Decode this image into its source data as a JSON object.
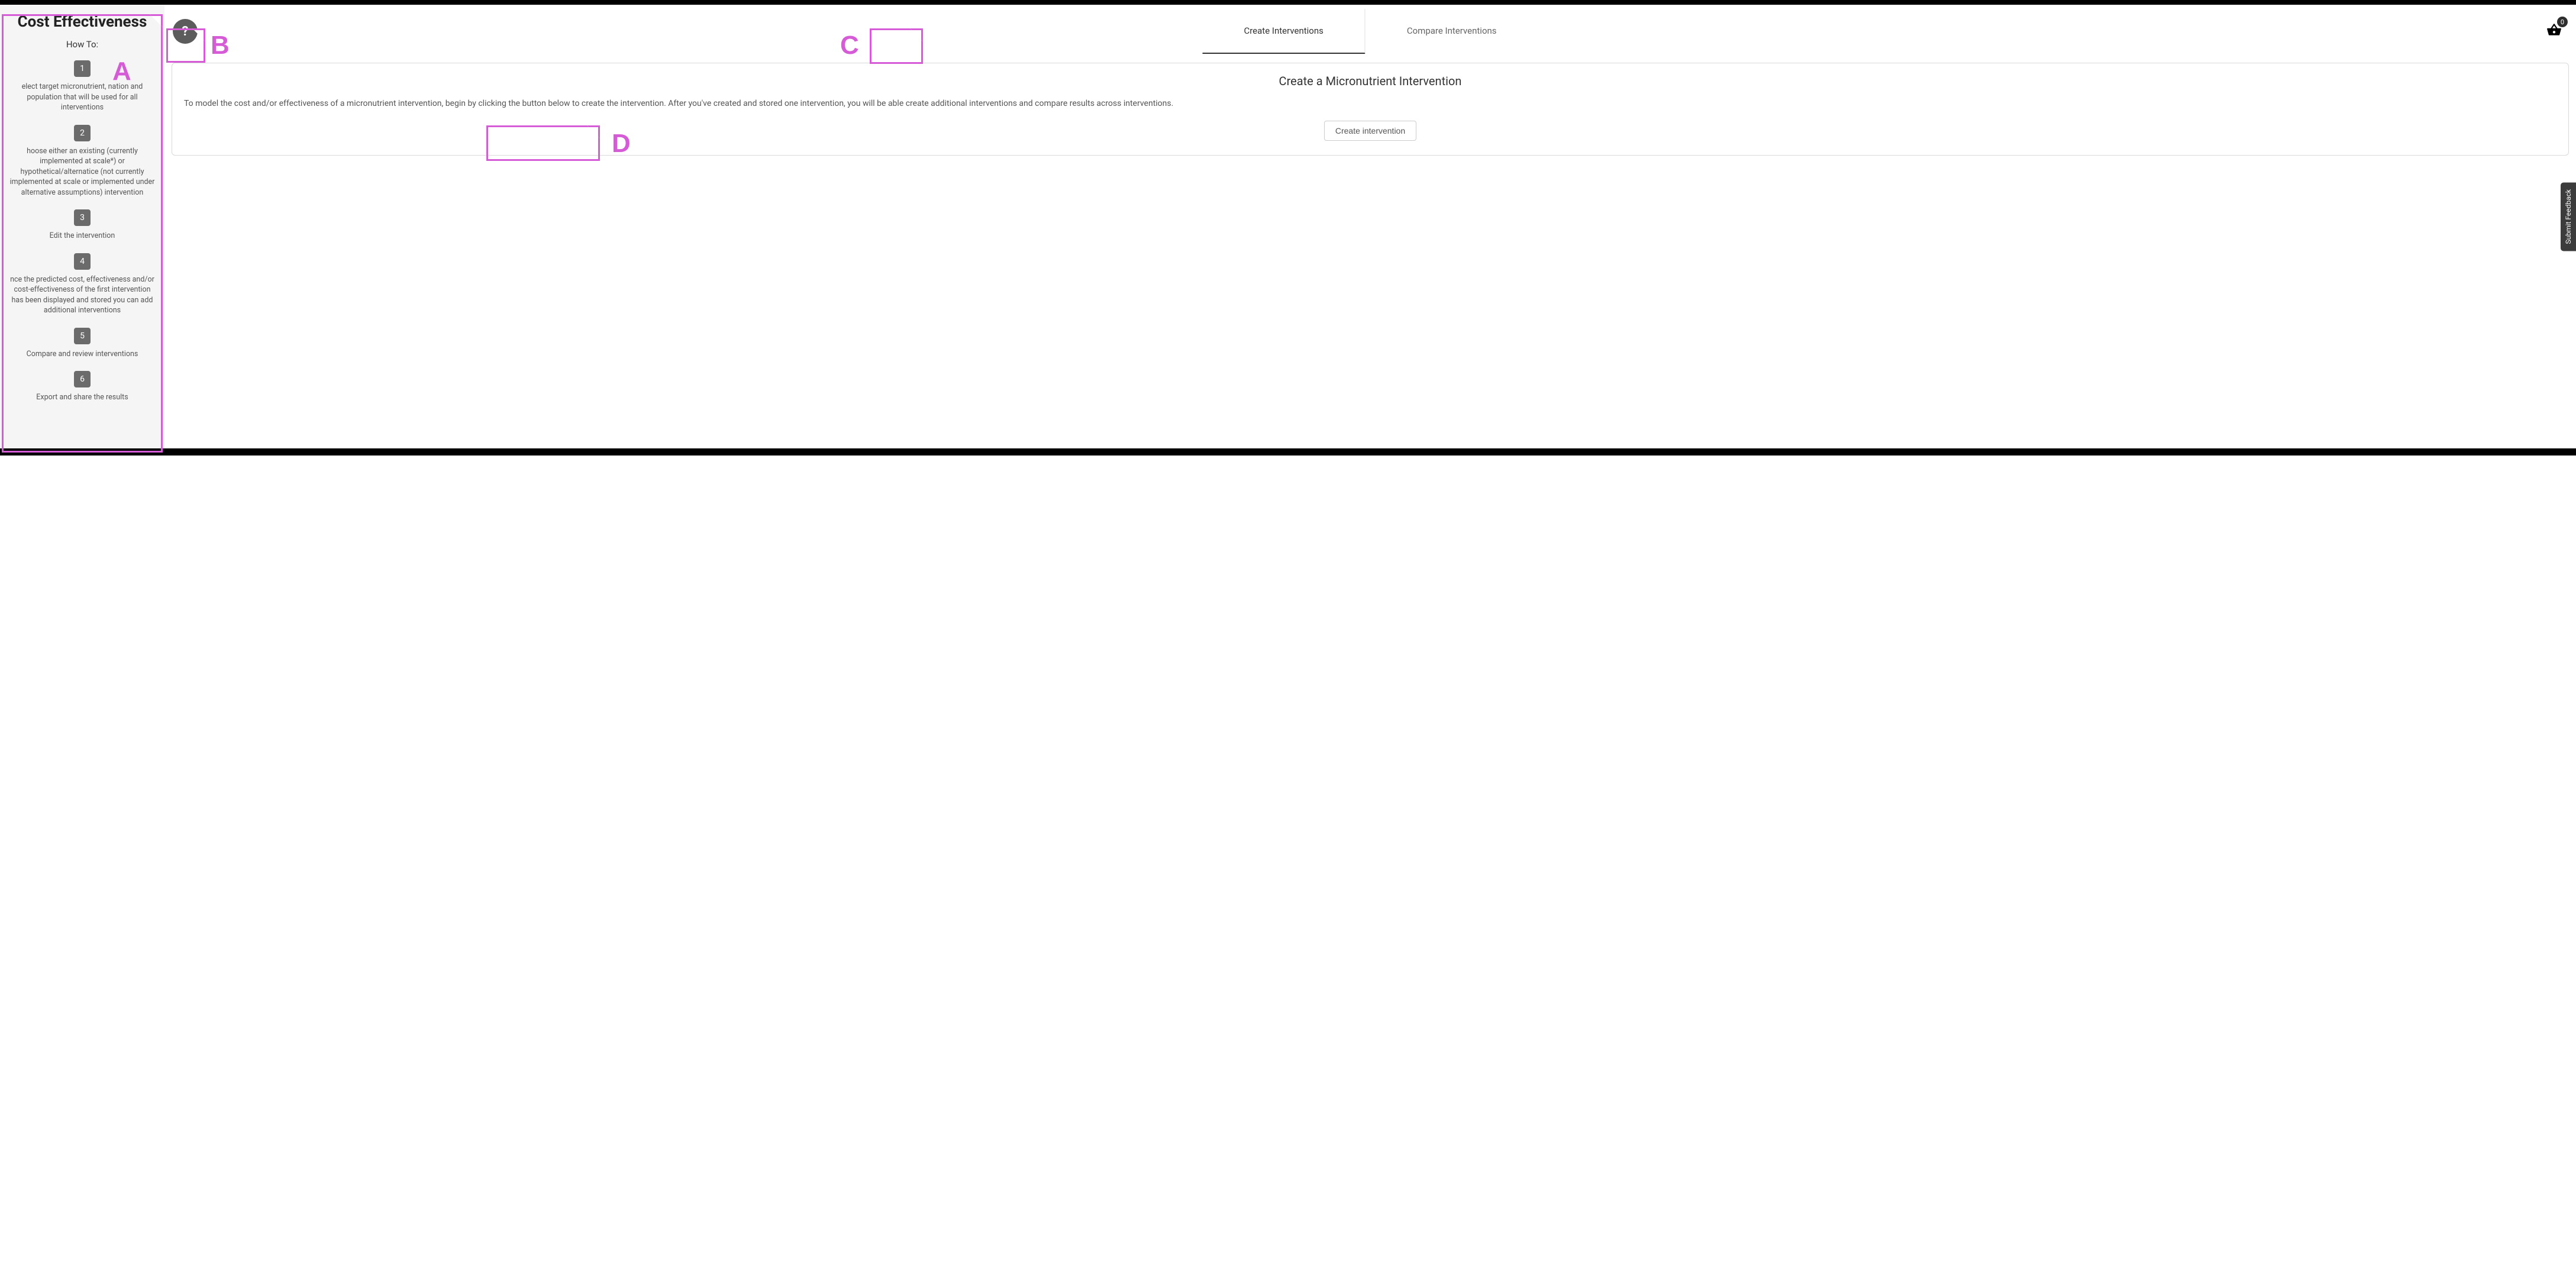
{
  "sidebar": {
    "title": "Cost Effectiveness",
    "howto_label": "How To:",
    "steps": [
      {
        "num": "1",
        "text": "elect target micronutrient, nation and population that will be used for all interventions"
      },
      {
        "num": "2",
        "text": "hoose either an existing (currently implemented at scale*) or hypothetical/alternatice (not currently implemented at scale or implemented under alternative assumptions) intervention"
      },
      {
        "num": "3",
        "text": "Edit the intervention"
      },
      {
        "num": "4",
        "text": "nce the predicted cost, effectiveness and/or cost-effectiveness of the first intervention has been displayed and stored you can add additional interventions"
      },
      {
        "num": "5",
        "text": "Compare and review interventions"
      },
      {
        "num": "6",
        "text": "Export and share the results"
      }
    ]
  },
  "topbar": {
    "help_glyph": "?",
    "tabs": [
      {
        "label": "Create Interventions",
        "active": true
      },
      {
        "label": "Compare Interventions",
        "active": false
      }
    ],
    "basket_count": "0"
  },
  "card": {
    "title": "Create a Micronutrient Intervention",
    "body": "To model the cost and/or effectiveness of a micronutrient intervention, begin by clicking the button below to create the intervention. After you've created and stored one intervention, you will be able create additional interventions and compare results across interventions.",
    "button_label": "Create intervention"
  },
  "feedback": {
    "label": "Submit Feedback"
  },
  "annotations": {
    "A": "A",
    "B": "B",
    "C": "C",
    "D": "D"
  }
}
